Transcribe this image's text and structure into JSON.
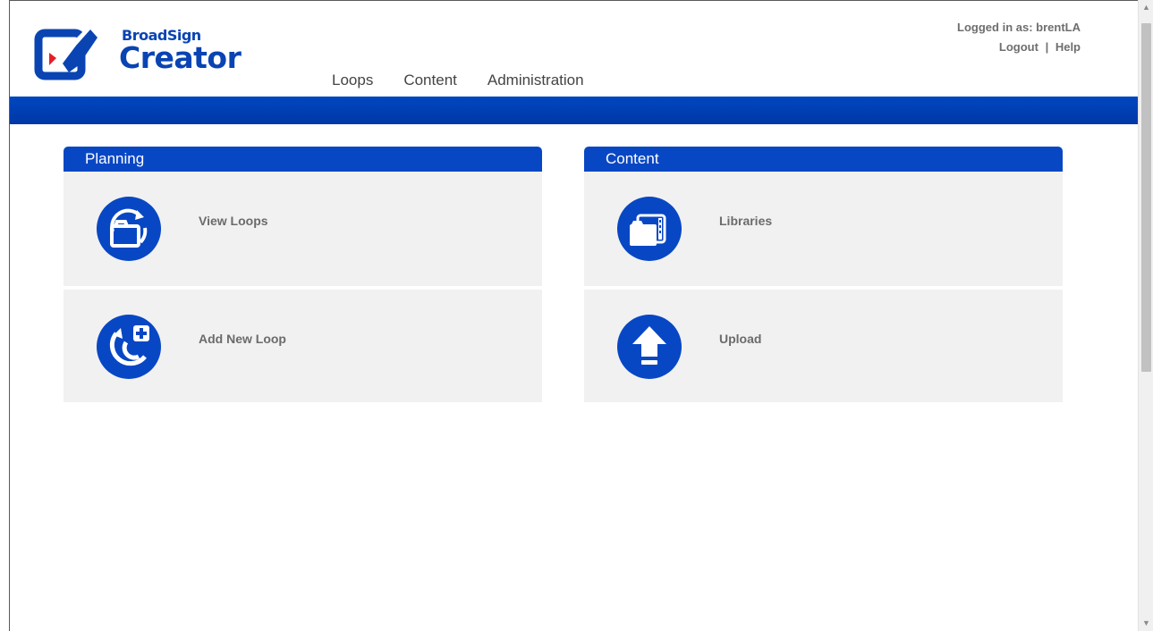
{
  "header": {
    "brand": "BroadSign",
    "product": "Creator",
    "nav": [
      "Loops",
      "Content",
      "Administration"
    ],
    "user_label": "Logged in as: brentLA",
    "logout_label": "Logout",
    "separator": "|",
    "help_label": "Help"
  },
  "panels": {
    "planning": {
      "title": "Planning",
      "tiles": [
        {
          "label": "View Loops",
          "icon": "view-loops-icon"
        },
        {
          "label": "Add New Loop",
          "icon": "add-loop-icon"
        }
      ]
    },
    "content": {
      "title": "Content",
      "tiles": [
        {
          "label": "Libraries",
          "icon": "libraries-icon"
        },
        {
          "label": "Upload",
          "icon": "upload-icon"
        }
      ]
    }
  },
  "colors": {
    "brand_blue": "#0a44b3",
    "bar_blue": "#0047c0",
    "tile_bg": "#f1f1f1",
    "label_gray": "#6b6b6b"
  }
}
